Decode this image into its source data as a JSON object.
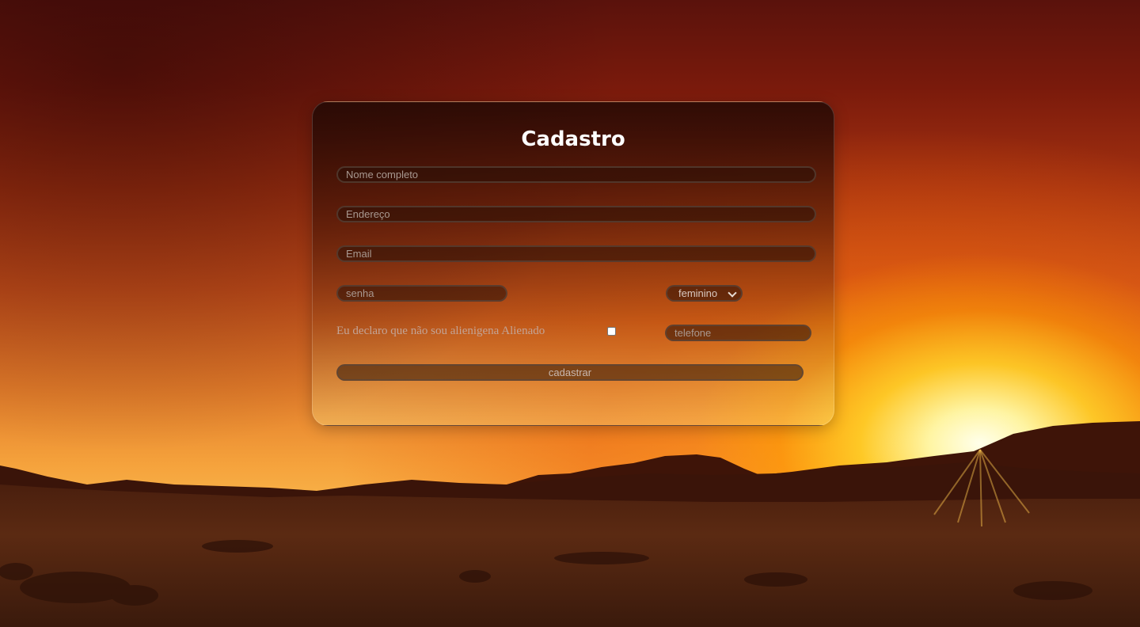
{
  "form": {
    "title": "Cadastro",
    "name_placeholder": "Nome completo",
    "address_placeholder": "Endereço",
    "email_placeholder": "Email",
    "password_placeholder": "senha",
    "gender_selected": "feminino",
    "declaration_label": "Eu declaro que não sou alienigena Alienado",
    "declaration_checked": false,
    "phone_placeholder": "telefone",
    "submit_label": "cadastrar"
  },
  "background": {
    "scene": "desert-sunset",
    "colors": {
      "sky_top": "#5a120c",
      "sky_mid": "#c8501a",
      "horizon": "#f8b248",
      "sun": "#fffbe0",
      "ground": "#3b1a0c"
    }
  }
}
